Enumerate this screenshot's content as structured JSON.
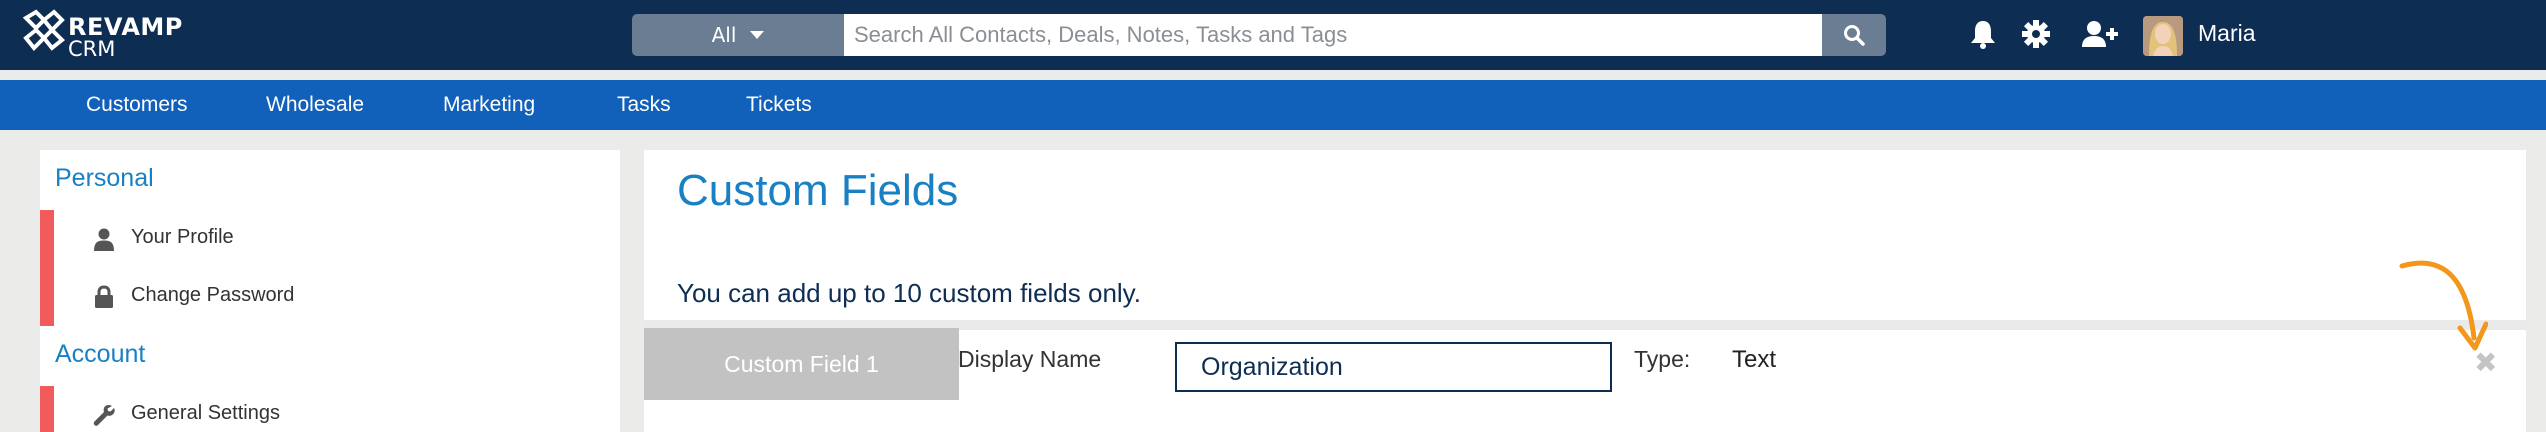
{
  "logo": {
    "line1": "REVAMP",
    "line2": "CRM"
  },
  "search": {
    "scope": "All",
    "placeholder": "Search All Contacts, Deals, Notes, Tasks and Tags",
    "value": ""
  },
  "user": {
    "name": "Maria"
  },
  "nav": [
    "Customers",
    "Wholesale",
    "Marketing",
    "Tasks",
    "Tickets"
  ],
  "sidebar": {
    "personal_heading": "Personal",
    "personal_items": [
      "Your Profile",
      "Change Password"
    ],
    "account_heading": "Account",
    "account_items": [
      "General Settings"
    ]
  },
  "main": {
    "title": "Custom Fields",
    "notice": "You can add up to 10 custom fields only.",
    "field": {
      "tab_label": "Custom Field 1",
      "display_name_label": "Display Name",
      "display_name_value": "Organization",
      "type_label": "Type:",
      "type_value": "Text",
      "remove_glyph": "✖"
    }
  },
  "colors": {
    "topbar": "#0d2d52",
    "navbar": "#1160b9",
    "accent": "#1a80c4",
    "sidebar_marker": "#f25b5b",
    "annotation": "#f3961c"
  }
}
